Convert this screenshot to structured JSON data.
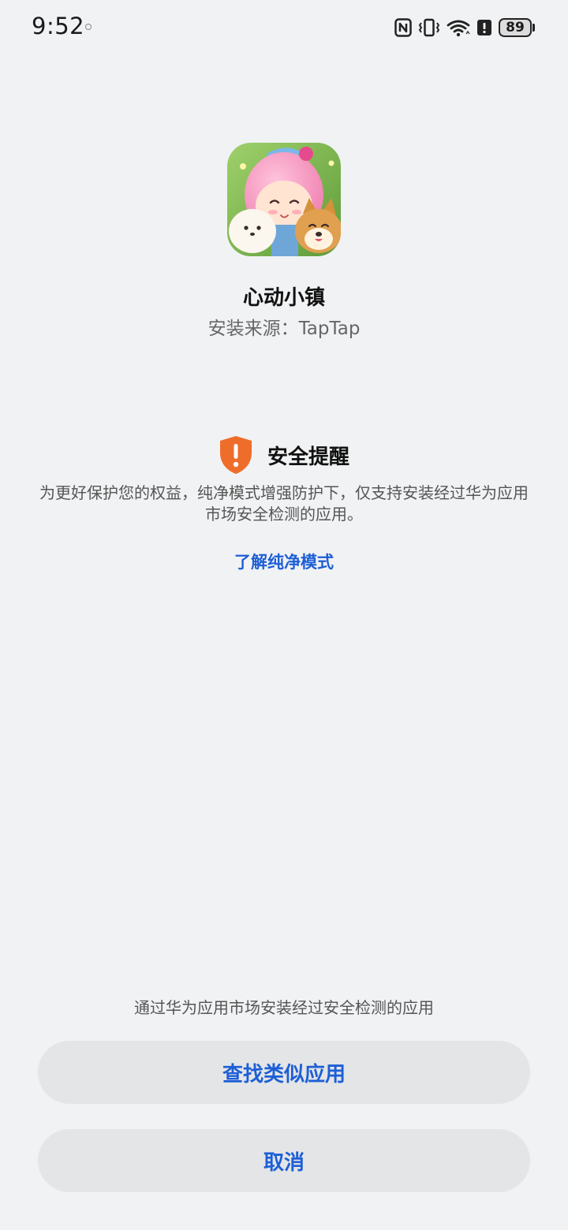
{
  "status_bar": {
    "time": "9:52",
    "battery_level": "89",
    "icons": [
      "nfc-icon",
      "vibrate-icon",
      "wifi-icon",
      "alert-icon",
      "battery-icon"
    ]
  },
  "app": {
    "icon": "app-icon-game-character",
    "name": "心动小镇",
    "install_source": "安装来源：TapTap"
  },
  "notice": {
    "icon": "shield-warning-icon",
    "title": "安全提醒",
    "body": "为更好保护您的权益，纯净模式增强防护下，仅支持安装经过华为应用市场安全检测的应用。",
    "link": "了解纯净模式"
  },
  "footer": {
    "hint": "通过华为应用市场安装经过安全检测的应用",
    "find_similar": "查找类似应用",
    "cancel": "取消"
  },
  "colors": {
    "background": "#f1f2f4",
    "accent": "#1d5fd6",
    "warning": "#ee6d2a",
    "button_bg": "#e4e5e7"
  }
}
